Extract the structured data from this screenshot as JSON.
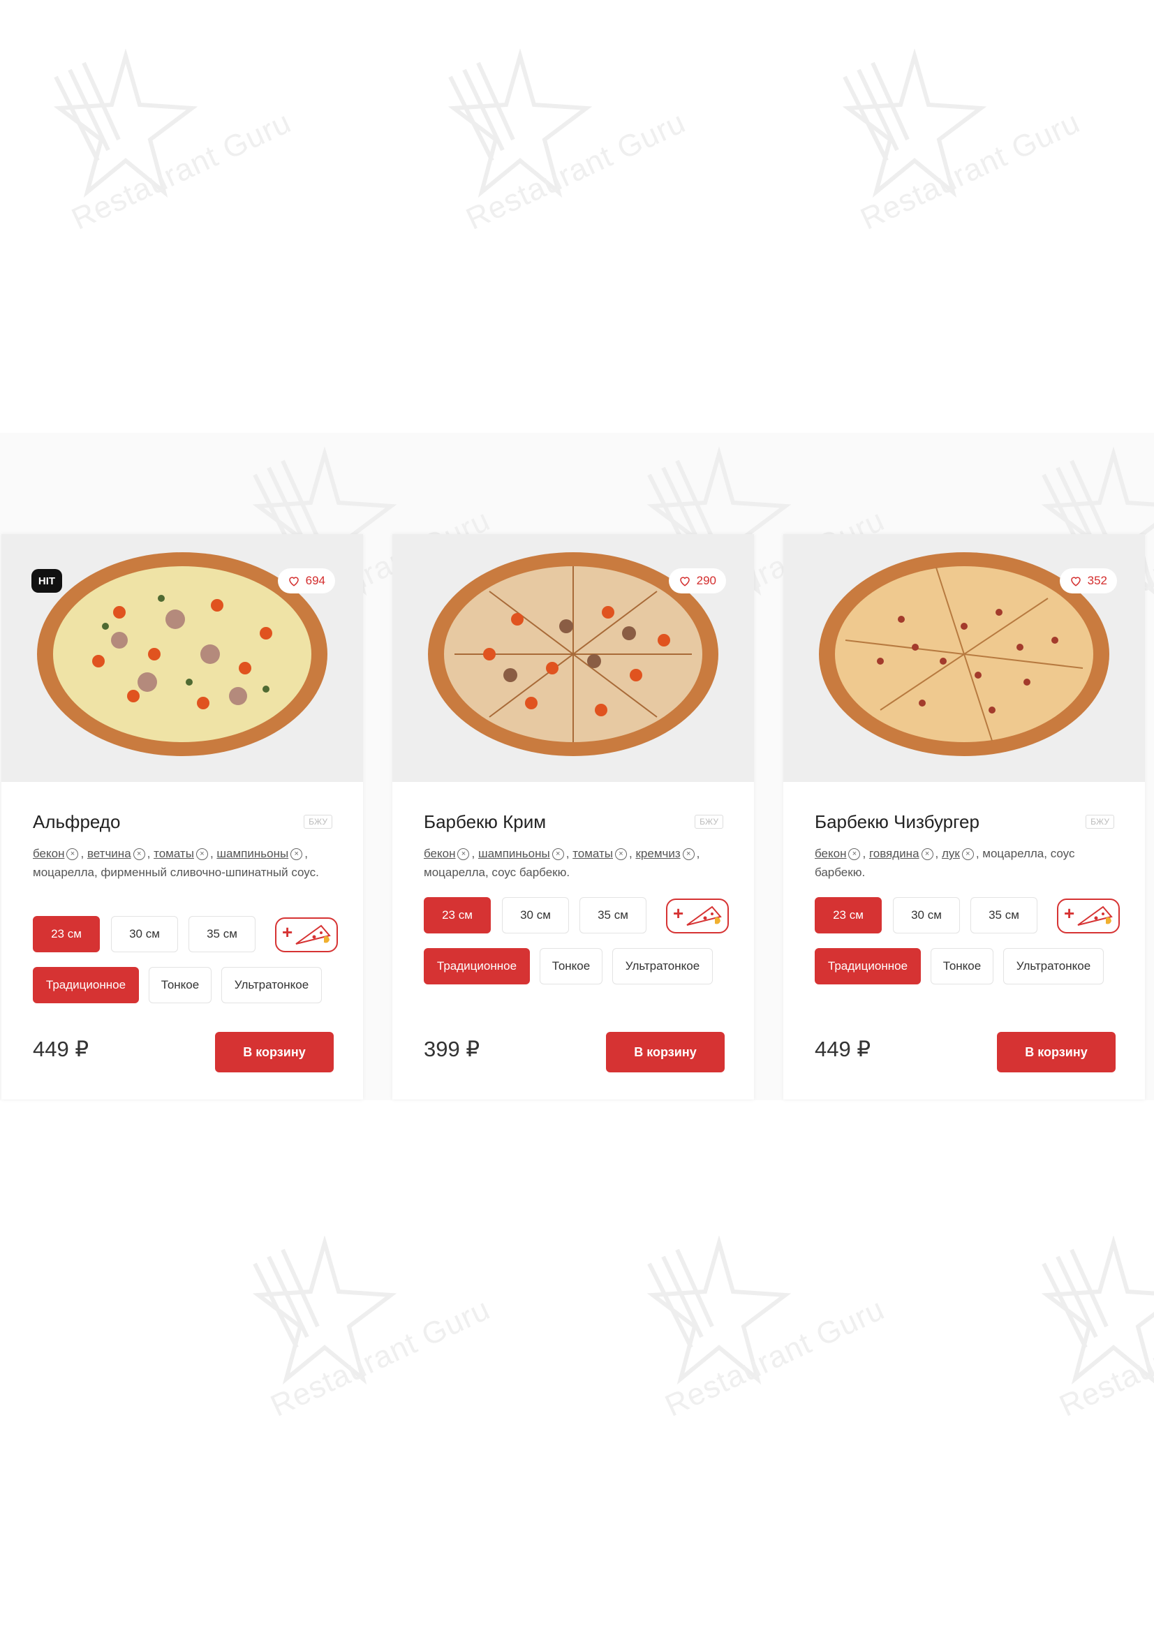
{
  "watermark_text": "Restaurant Guru",
  "colors": {
    "accent": "#d63333",
    "badge": "#111111"
  },
  "cards": [
    {
      "badge": "HIT",
      "likes": "694",
      "title": "Альфредо",
      "bju": "БЖУ",
      "ingredients": [
        "бекон",
        "ветчина",
        "томаты",
        "шампиньоны"
      ],
      "desc_rest": ", моцарелла, фирменный сливочно-шпинатный соус.",
      "sizes": [
        "23 см",
        "30 см",
        "35 см"
      ],
      "selected_size": "23 см",
      "crusts": [
        "Традиционное",
        "Тонкое",
        "Ультратонкое"
      ],
      "selected_crust": "Традиционное",
      "addons_icon": "pizza-slice-plus-icon",
      "price": "449 ₽",
      "cart_label": "В корзину"
    },
    {
      "badge": "",
      "likes": "290",
      "title": "Барбекю Крим",
      "bju": "БЖУ",
      "ingredients": [
        "бекон",
        "шампиньоны",
        "томаты",
        "кремчиз"
      ],
      "desc_rest": ", моцарелла, соус барбекю.",
      "sizes": [
        "23 см",
        "30 см",
        "35 см"
      ],
      "selected_size": "23 см",
      "crusts": [
        "Традиционное",
        "Тонкое",
        "Ультратонкое"
      ],
      "selected_crust": "Традиционное",
      "addons_icon": "pizza-slice-plus-icon",
      "price": "399 ₽",
      "cart_label": "В корзину"
    },
    {
      "badge": "",
      "likes": "352",
      "title": "Барбекю Чизбургер",
      "bju": "БЖУ",
      "ingredients": [
        "бекон",
        "говядина",
        "лук"
      ],
      "desc_rest": ", моцарелла, соус барбекю.",
      "sizes": [
        "23 см",
        "30 см",
        "35 см"
      ],
      "selected_size": "23 см",
      "crusts": [
        "Традиционное",
        "Тонкое",
        "Ультратонкое"
      ],
      "selected_crust": "Традиционное",
      "addons_icon": "pizza-slice-plus-icon",
      "price": "449 ₽",
      "cart_label": "В корзину"
    }
  ]
}
